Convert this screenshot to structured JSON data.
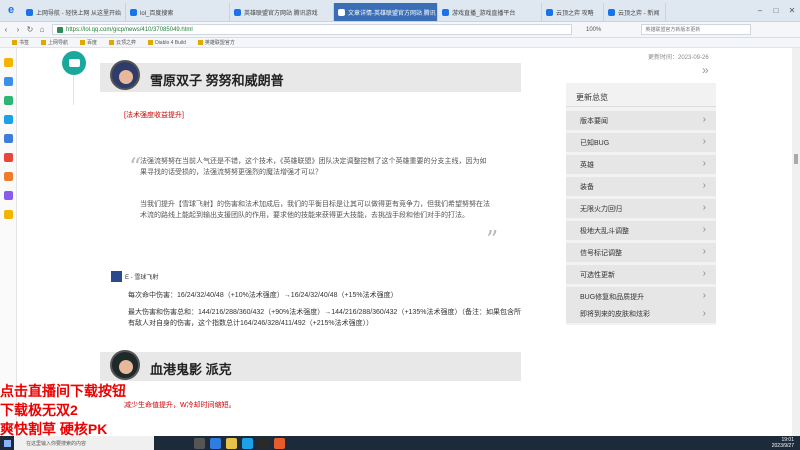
{
  "browser": {
    "tabs": [
      {
        "label": "上网导航 - 轻快上网 从这里开始"
      },
      {
        "label": "lol_百度搜索"
      },
      {
        "label": "英雄联盟官方网站 腾讯游戏"
      },
      {
        "label": "文章详情-英雄联盟官方网站 腾讯"
      },
      {
        "label": "游戏直播_游戏直播平台"
      },
      {
        "label": "云顶之弈 攻略"
      },
      {
        "label": "云顶之弈 - 新闻"
      }
    ],
    "url": "https://lol.qq.com/gicp/news/410/37085049.html",
    "zoom": "100%",
    "search_placeholder": "英雄联盟官方新版本更新",
    "bookmarks": [
      "书签",
      "上网导航",
      "百度",
      "云顶之弈",
      "Diablo 4 Build",
      "英雄联盟官方"
    ]
  },
  "article": {
    "date": "更新时间：2023-09-26",
    "hero1_title": "雪原双子 努努和威朗普",
    "hero1_tag": "[法术强度收益提升]",
    "quote_p1": "法强流努努在当前人气还是不错，这个技术，《英雄联盟》团队决定调整控制了这个英雄重要的分支主线，因为如果寻找的话受损的，法强流努努更强烈的魔法增强才可以？",
    "quote_p2": "当我们提升【雪球飞射】的伤害和法术加成后，我们的平衡目标是让其可以做得更有竞争力，但我们希望努努在法术流的路线上能起到输出支援团队的作用，要求他的技能来获得更大技能，去挑战手段和他们对手的打法。",
    "skill_name": "E - 雪球飞射",
    "detail1": "每次命中伤害：16/24/32/40/48（+10%法术强度）→16/24/32/40/48（+15%法术强度）",
    "detail2": "最大伤害和伤害总和：144/216/288/360/432（+90%法术强度）→144/216/288/360/432（+135%法术强度）（备注：如果包含所有敌人对自身的伤害，这个指数总计164/246/328/411/492（+215%法术强度））",
    "hero2_title": "血港鬼影 派克",
    "hero2_tag": "减少生命值提升，W冷却时间缩短。"
  },
  "sidebar_panel": {
    "title": "更新总览",
    "items": [
      "版本要闻",
      "已知BUG",
      "英雄",
      "装备",
      "无限火力回归",
      "极地大乱斗调整",
      "信号标记调整",
      "可选性更新",
      "BUG修复和品质提升",
      "即将到来的皮肤和炫彩"
    ]
  },
  "overlay_text": [
    "点击直播间下载按钮",
    "下载极无双2",
    "爽快割草  硬核PK"
  ],
  "taskbar": {
    "search_placeholder": "在这里输入你要搜索的内容",
    "time": "19:01",
    "date": "2023/9/27"
  },
  "colors": {
    "accent": "#cc0000",
    "chat": "#1aa89a"
  }
}
